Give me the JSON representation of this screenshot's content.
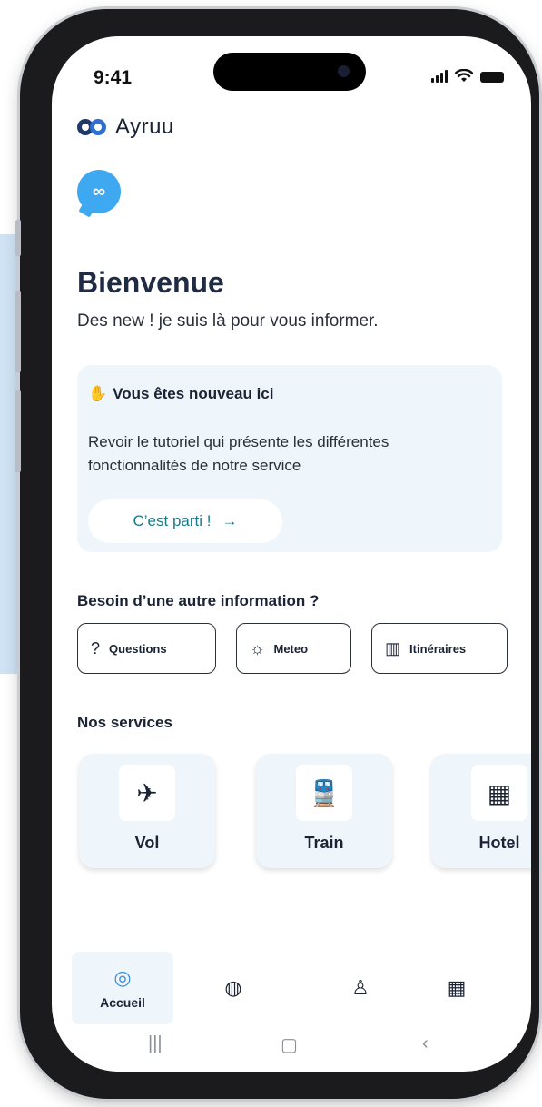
{
  "status": {
    "time": "9:41"
  },
  "brand": {
    "name": "Ayruu"
  },
  "welcome": {
    "title": "Bienvenue",
    "subtitle": "Des new ! je suis là pour vous informer."
  },
  "tutorial_card": {
    "heading": "Vous êtes nouveau ici",
    "body": "Revoir le tutoriel qui présente les différentes fonctionnalités de notre service",
    "cta_label": "C’est parti !",
    "cta_arrow": "→"
  },
  "info": {
    "title": "Besoin d’une autre information ?",
    "chips": [
      {
        "label": "Questions",
        "icon": "question-circle-icon",
        "glyph": "?"
      },
      {
        "label": "Meteo",
        "icon": "sun-icon",
        "glyph": "☼"
      },
      {
        "label": "Itinéraires",
        "icon": "map-icon",
        "glyph": "▥"
      }
    ]
  },
  "services": {
    "title": "Nos services",
    "items": [
      {
        "label": "Vol",
        "icon": "plane-icon",
        "glyph": "✈"
      },
      {
        "label": "Train",
        "icon": "train-icon",
        "glyph": "🚆"
      },
      {
        "label": "Hotel",
        "icon": "building-icon",
        "glyph": "▦"
      }
    ]
  },
  "tabbar": {
    "items": [
      {
        "label": "Accueil",
        "icon": "chat-bubble-icon",
        "glyph": "◎"
      },
      {
        "label": "",
        "icon": "globe-icon",
        "glyph": "◍"
      },
      {
        "label": "",
        "icon": "user-icon",
        "glyph": "♙"
      },
      {
        "label": "",
        "icon": "building-icon",
        "glyph": "▦"
      }
    ]
  },
  "system_nav": {
    "recent": "|||",
    "home": "▢",
    "back": "‹"
  },
  "colors": {
    "accent": "#3ea8f0",
    "brand_dark": "#1e3a6b",
    "card_bg": "#eef5fb",
    "cta_text": "#1b7a8a"
  }
}
